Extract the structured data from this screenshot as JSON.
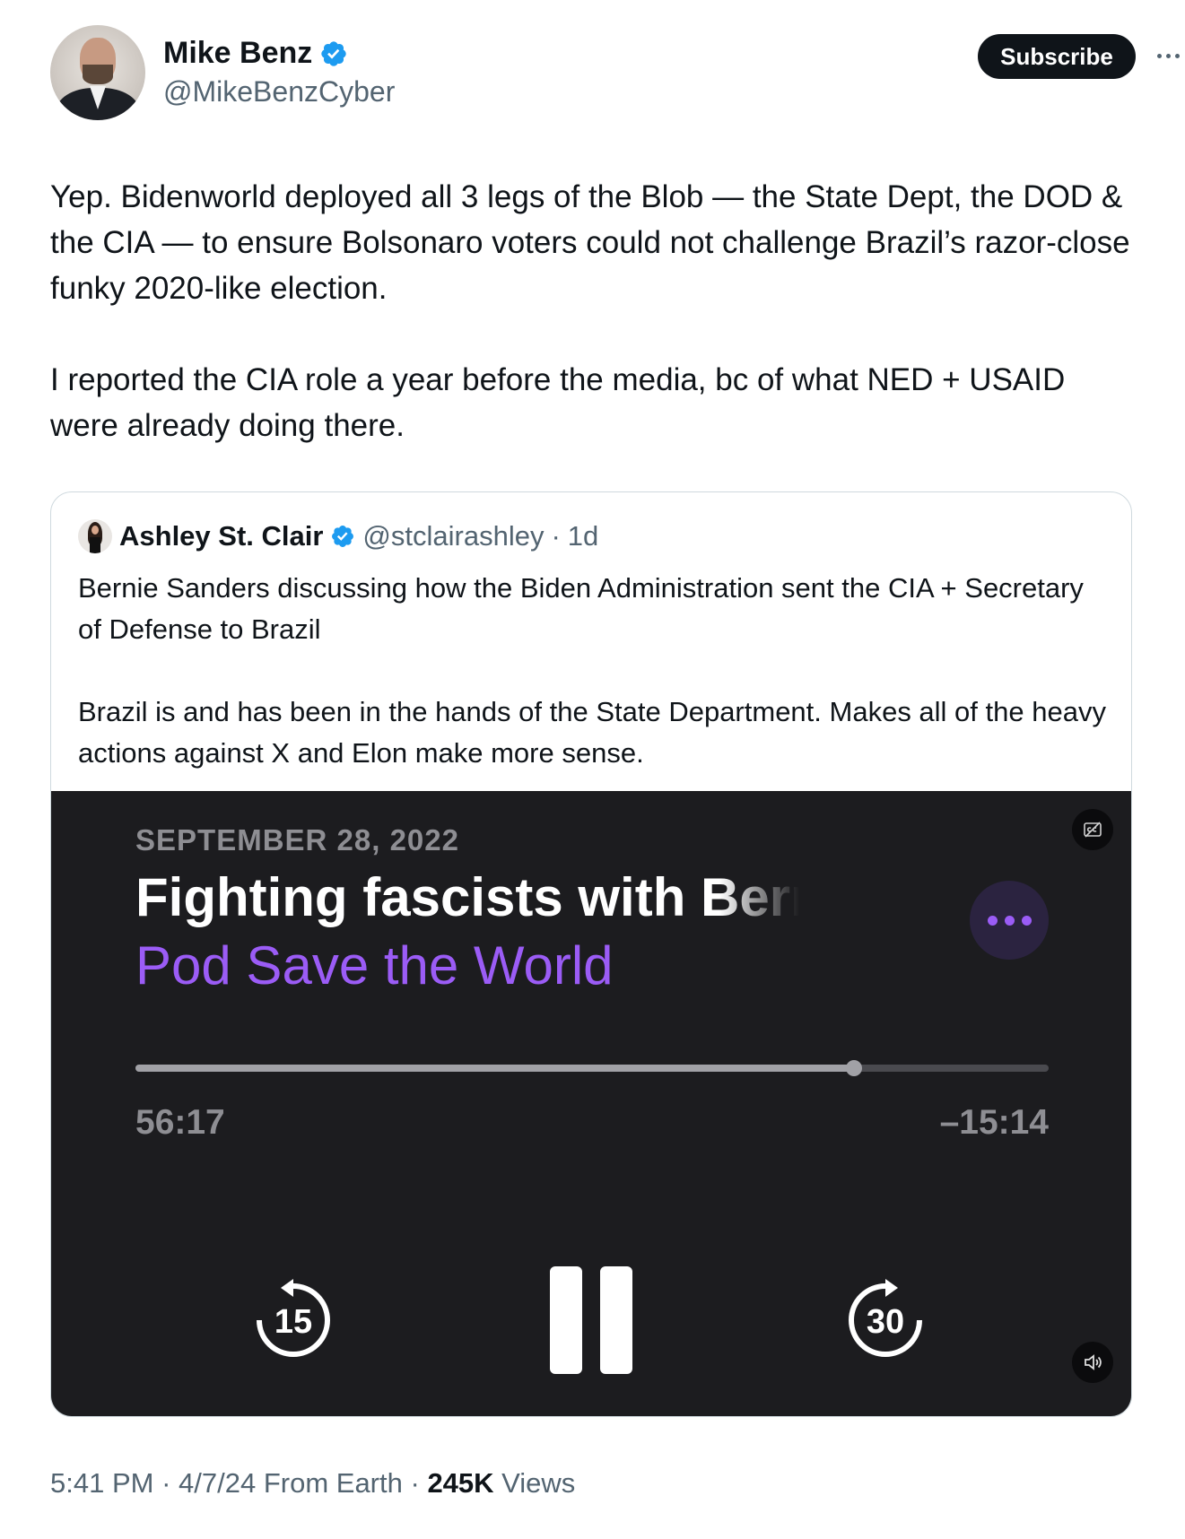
{
  "author": {
    "name": "Mike Benz",
    "handle": "@MikeBenzCyber",
    "verified": true
  },
  "actions": {
    "subscribe_label": "Subscribe",
    "more_icon": "more-horizontal-icon"
  },
  "tweet": {
    "text": "Yep. Bidenworld deployed all 3 legs of the Blob — the State Dept, the DOD & the CIA — to ensure Bolsonaro voters could not challenge Brazil’s razor-close funky 2020-like election.\n\nI reported the CIA role a year before the media, bc of what NED + USAID were already doing there."
  },
  "quote": {
    "name": "Ashley St. Clair",
    "handle": "@stclairashley",
    "separator": "·",
    "age": "1d",
    "text": "Bernie Sanders discussing how the Biden Administration sent the CIA + Secretary of Defense to Brazil\n\nBrazil is and has been in the hands of the State Department. Makes all of the heavy actions against X and Elon make more sense."
  },
  "media": {
    "date": "SEPTEMBER 28, 2022",
    "episode_title": "Fighting fascists with Bernie Sanders",
    "show_name": "Pod Save the World",
    "elapsed": "56:17",
    "remaining": "–15:14",
    "progress_fraction": 0.787,
    "skip_back_seconds": "15",
    "skip_forward_seconds": "30",
    "accent_color": "#9b5cf6",
    "background_color": "#1c1c1f"
  },
  "footer": {
    "time": "5:41 PM",
    "sep1": " · ",
    "date": "4/7/24",
    "source": " From Earth",
    "sep2": " · ",
    "views_count": "245K",
    "views_label": " Views"
  },
  "colors": {
    "verified_blue": "#1d9bf0",
    "text_primary": "#0f1419",
    "text_secondary": "#536471"
  }
}
